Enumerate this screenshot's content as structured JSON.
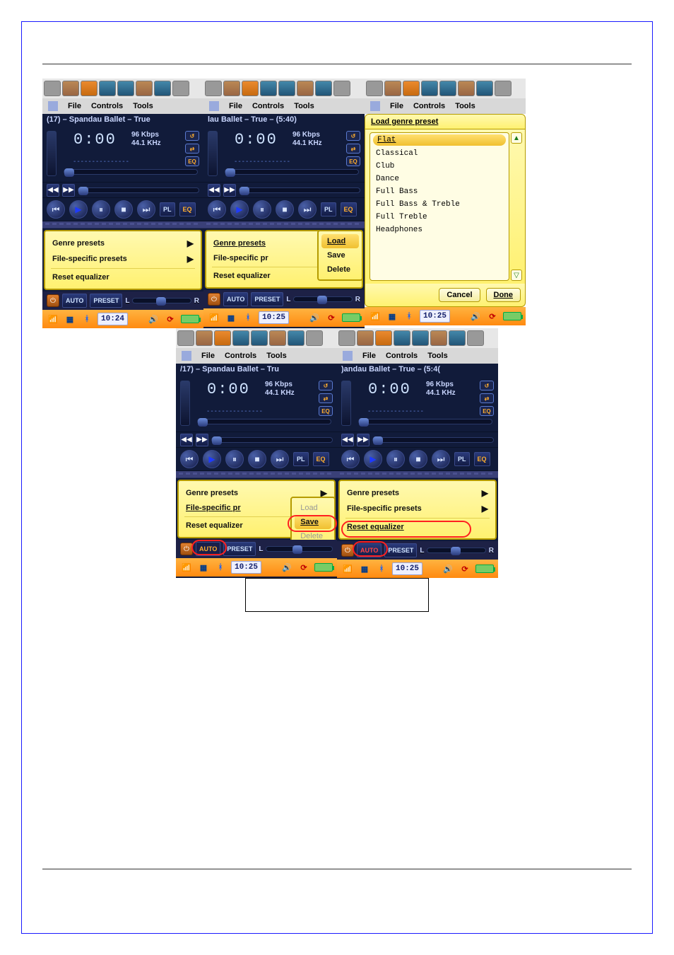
{
  "common": {
    "menubar": {
      "file": "File",
      "controls": "Controls",
      "tools": "Tools"
    },
    "display": {
      "time": "0:00",
      "bitrate": "96 Kbps",
      "samplerate": "44.1 KHz",
      "eq_label": "EQ"
    },
    "buttons": {
      "pl": "PL",
      "eq": "EQ",
      "auto": "AUTO",
      "preset": "PRESET",
      "L": "L",
      "R": "R"
    },
    "eq_menu": {
      "genre": "Genre presets",
      "file": "File-specific presets",
      "file_short": "File-specific pr",
      "reset": "Reset equalizer"
    },
    "submenu": {
      "load": "Load",
      "save": "Save",
      "delete": "Delete"
    },
    "status": {
      "signal": "signal",
      "grid": "grid",
      "bt": "bt"
    },
    "toolbar_icons": [
      "app",
      "book",
      "globe",
      "phone",
      "note",
      "folder",
      "grid",
      "app"
    ]
  },
  "row1": {
    "s1": {
      "title": "(17) – Spandau Ballet – True",
      "clock": "10:24",
      "genre_underline": false
    },
    "s2": {
      "title": "lau Ballet – True – (5:40)",
      "clock": "10:25",
      "genre_underline": true,
      "submenu_visible": true
    },
    "dialog": {
      "title": "Load genre preset",
      "items": [
        "Flat",
        "Classical",
        "Club",
        "Dance",
        "Full Bass",
        "Full Bass & Treble",
        "Full Treble",
        "Headphones"
      ],
      "selected": "Flat",
      "cancel": "Cancel",
      "done": "Done",
      "clock": "10:25"
    }
  },
  "row2": {
    "s4": {
      "title": "/17) – Spandau Ballet – Tru",
      "clock": "10:25",
      "file_underline": true,
      "submenu_visible": true,
      "submenu_sel": "Save",
      "load_disabled": true
    },
    "s5": {
      "title": ")andau Ballet – True – (5:4(",
      "clock": "10:25",
      "reset_underline": true
    }
  }
}
